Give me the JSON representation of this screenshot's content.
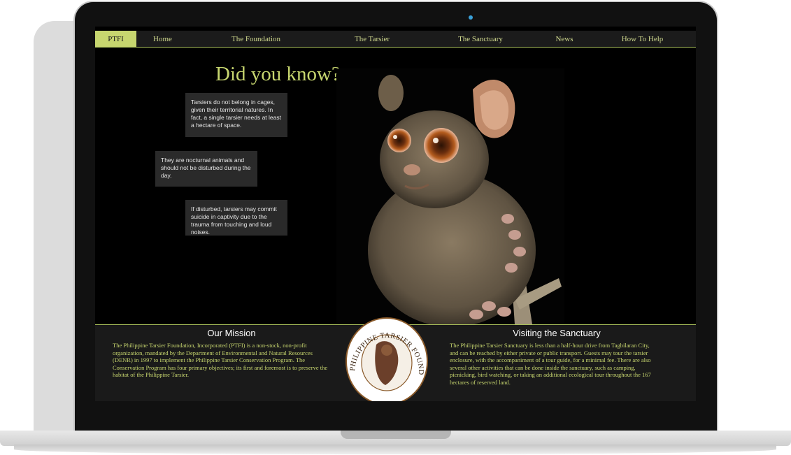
{
  "nav": {
    "items": [
      {
        "label": "PTFI",
        "active": true
      },
      {
        "label": "Home",
        "active": false
      },
      {
        "label": "The Foundation",
        "active": false
      },
      {
        "label": "The Tarsier",
        "active": false
      },
      {
        "label": "The Sanctuary",
        "active": false
      },
      {
        "label": "News",
        "active": false
      },
      {
        "label": "How To Help",
        "active": false
      }
    ]
  },
  "hero": {
    "heading": "Did you know?",
    "facts": [
      "Tarsiers do not belong in cages, given their territorial natures. In fact, a single tarsier needs at least a hectare of space.",
      "They are nocturnal animals and should not be disturbed during the day.",
      "If disturbed, tarsiers may commit suicide in captivity due to the trauma from touching and loud noises."
    ]
  },
  "mission": {
    "title": "Our Mission",
    "text": "The Philippine Tarsier Foundation, Incorporated (PTFI) is a non-stock, non-profit organization, mandated by the Department of Environmental and Natural Resources (DENR) in 1997 to implement the Philippine Tarsier Conservation Program. The Conservation Program has four primary objectives; its first and foremost is to preserve the habitat of the Philippine Tarsier."
  },
  "visit": {
    "title": "Visiting the Sanctuary",
    "text": "The Philippine Tarsier Sanctuary is less than a half-hour drive from Tagbilaran City, and can be reached by either private or public transport. Guests may tour the tarsier enclosure, with the accompaniment of a tour guide, for a minimal fee. There are also several other activities that can be done inside the sanctuary, such as camping, picnicking, bird watching, or taking an additional ecological tour throughout the 167 hectares of reserved land."
  },
  "seal": {
    "text": "PHILIPPINE TARSIER FOUNDATION INC"
  },
  "colors": {
    "accent": "#c7d66f",
    "background": "#000000",
    "panel": "#1a1a1a"
  }
}
